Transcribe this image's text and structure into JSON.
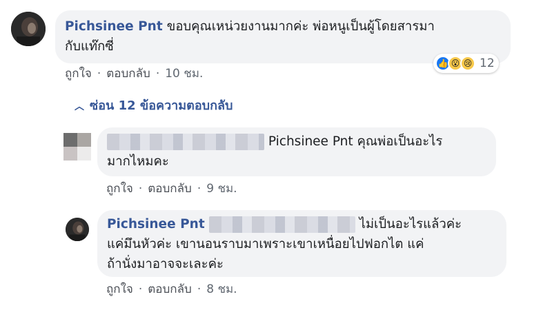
{
  "comment1": {
    "author": "Pichsinee Pnt",
    "text_line1": "ขอบคุณเหน่วยงานมากค่ะ พ่อหนูเป็นผู้โดยสารมา",
    "text_line2": "กับแท๊กซี่",
    "like": "ถูกใจ",
    "reply": "ตอบกลับ",
    "time": "10 ชม.",
    "reaction_count": "12"
  },
  "hide_replies": "ซ่อน 12 ข้อความตอบกลับ",
  "reply1": {
    "mention": "Pichsinee Pnt",
    "text_line1": " คุณพ่อเป็นอะไร",
    "text_line2": "มากไหมคะ",
    "like": "ถูกใจ",
    "reply": "ตอบกลับ",
    "time": "9 ชม."
  },
  "reply2": {
    "author": "Pichsinee Pnt",
    "text_line1": "ไม่เป็นอะไรแล้วค่ะ",
    "text_line2": "แค่มึนหัวค่ะ เขานอนราบมาเพราะเขาเหนื่อยไปฟอกไต แค่",
    "text_line3": "ถ้านั่งมาอาจจะเละค่ะ",
    "like": "ถูกใจ",
    "reply": "ตอบกลับ",
    "time": "8 ชม."
  },
  "colors": {
    "author": "#385898",
    "bubble": "#f2f3f5",
    "meta": "#606770",
    "like_reaction": "#1877f2"
  },
  "icons": [
    "like-reaction-icon",
    "wow-reaction-icon",
    "sad-reaction-icon",
    "chevron-up-icon"
  ]
}
